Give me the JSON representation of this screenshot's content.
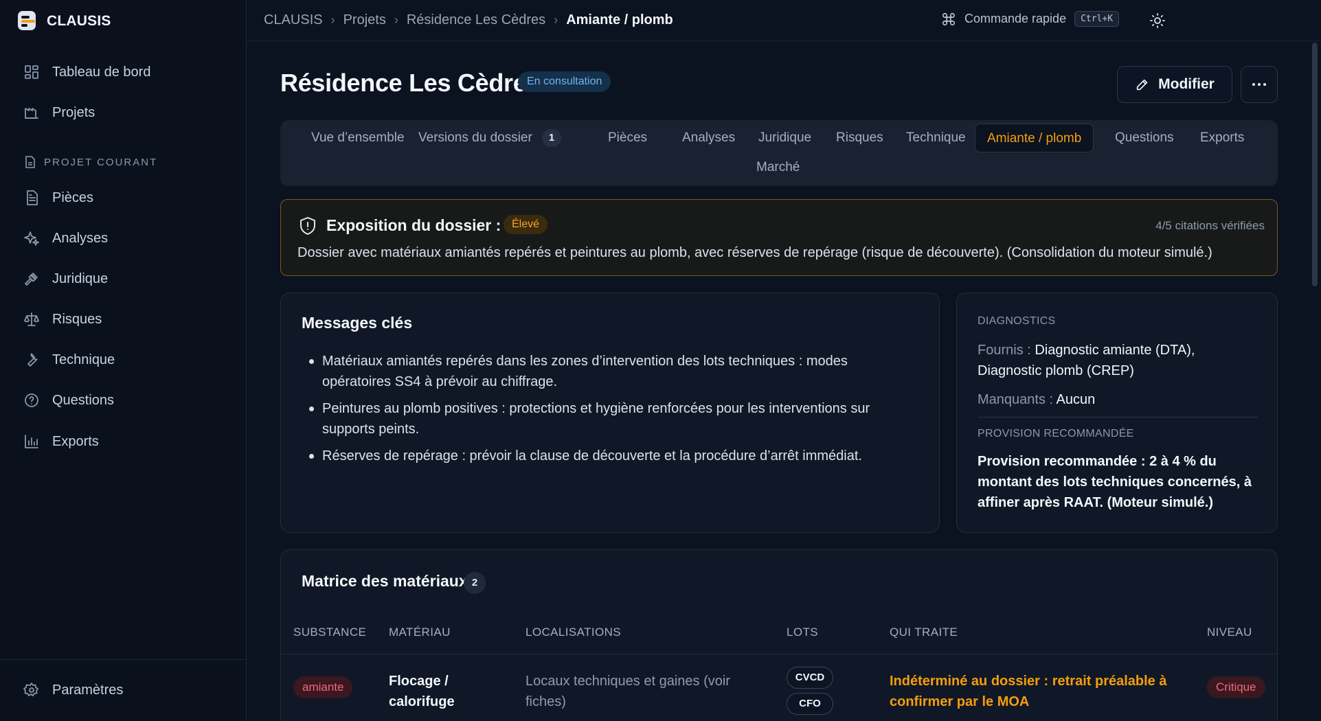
{
  "app": {
    "name": "CLAUSIS"
  },
  "sidebar": {
    "items": [
      {
        "label": "Tableau de bord",
        "icon": "dashboard-icon"
      },
      {
        "label": "Projets",
        "icon": "projects-icon"
      }
    ],
    "section_label": "PROJET COURANT",
    "project_items": [
      {
        "label": "Pièces",
        "icon": "document-icon"
      },
      {
        "label": "Analyses",
        "icon": "sparkles-icon"
      },
      {
        "label": "Juridique",
        "icon": "gavel-icon"
      },
      {
        "label": "Risques",
        "icon": "scale-icon"
      },
      {
        "label": "Technique",
        "icon": "wrench-icon"
      },
      {
        "label": "Questions",
        "icon": "help-circle-icon"
      },
      {
        "label": "Exports",
        "icon": "bar-chart-icon"
      }
    ],
    "settings_label": "Paramètres"
  },
  "topbar": {
    "breadcrumb": [
      "CLAUSIS",
      "Projets",
      "Résidence Les Cèdres",
      "Amiante / plomb"
    ],
    "command_label": "Commande rapide",
    "command_shortcut": "Ctrl+K"
  },
  "header": {
    "title": "Résidence Les Cèdres",
    "status": "En consultation",
    "modify_label": "Modifier"
  },
  "tabs": [
    {
      "label": "Vue d’ensemble"
    },
    {
      "label": "Versions du dossier",
      "count": "1"
    },
    {
      "label": "Pièces"
    },
    {
      "label": "Analyses"
    },
    {
      "label": "Juridique"
    },
    {
      "label": "Risques"
    },
    {
      "label": "Technique"
    },
    {
      "label": "Amiante / plomb",
      "active": true
    },
    {
      "label": "Questions"
    },
    {
      "label": "Exports"
    },
    {
      "label": "Marché"
    }
  ],
  "exposure": {
    "title": "Exposition du dossier :",
    "level": "Élevé",
    "citations": "4/5 citations vérifiées",
    "description": "Dossier avec matériaux amiantés repérés et peintures au plomb, avec réserves de repérage (risque de découverte). (Consolidation du moteur simulé.)"
  },
  "messages": {
    "title": "Messages clés",
    "items": [
      "Matériaux amiantés repérés dans les zones d’intervention des lots techniques : modes opératoires SS4 à prévoir au chiffrage.",
      "Peintures au plomb positives : protections et hygiène renforcées pour les interventions sur supports peints.",
      "Réserves de repérage : prévoir la clause de découverte et la procédure d’arrêt immédiat."
    ]
  },
  "diagnostics": {
    "label": "DIAGNOSTICS",
    "provided_key": "Fournis :",
    "provided_value": "Diagnostic amiante (DTA), Diagnostic plomb (CREP)",
    "missing_key": "Manquants :",
    "missing_value": "Aucun",
    "provision_label": "PROVISION RECOMMANDÉE",
    "provision_text": "Provision recommandée : 2 à 4 % du montant des lots techniques concernés, à affiner après RAAT. (Moteur simulé.)"
  },
  "matrix": {
    "title": "Matrice des matériaux",
    "count": "2",
    "columns": [
      "SUBSTANCE",
      "MATÉRIAU",
      "LOCALISATIONS",
      "LOTS",
      "QUI TRAITE",
      "NIVEAU"
    ],
    "rows": [
      {
        "substance": "amiante",
        "material": "Flocage / calorifuge",
        "locations": "Locaux techniques et gaines (voir fiches)",
        "lots": [
          "CVCD",
          "CFO"
        ],
        "who": "Indéterminé au dossier : retrait préalable à confirmer par le MOA",
        "level": "Critique"
      }
    ]
  },
  "colors": {
    "accent": "#f59e0b",
    "background": "#0b1220",
    "critical": "#f06a78",
    "info": "#74b6ee"
  }
}
